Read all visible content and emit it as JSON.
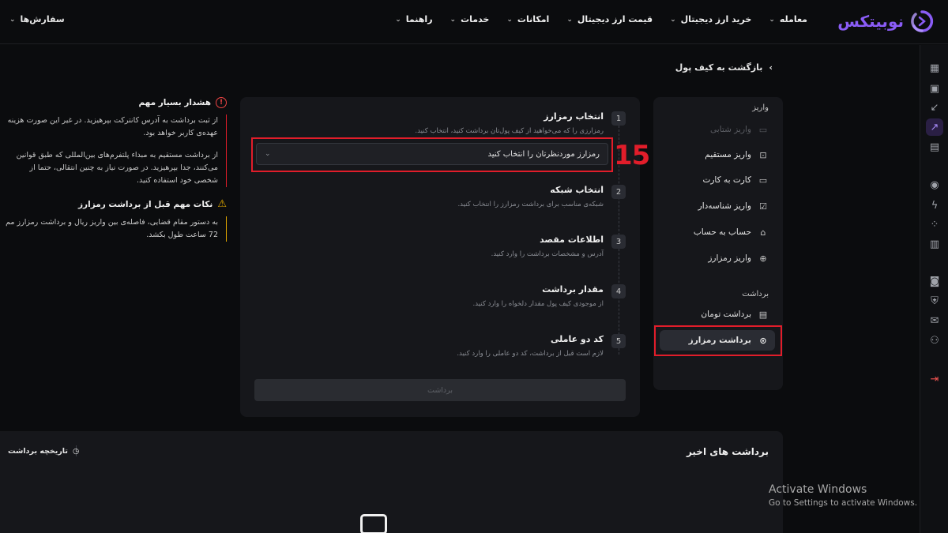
{
  "nav": {
    "logo_text": "نوبیتکس",
    "menu": [
      {
        "label": "معامله"
      },
      {
        "label": "خرید ارز دیجیتال"
      },
      {
        "label": "قیمت ارز دیجیتال"
      },
      {
        "label": "امکانات"
      },
      {
        "label": "خدمات"
      },
      {
        "label": "راهنما"
      }
    ],
    "orders_label": "سفارش‌ها"
  },
  "breadcrumb": {
    "back_label": "بازگشت به کیف پول"
  },
  "side": {
    "deposit_heading": "واریز",
    "deposit_items": [
      {
        "label": "واریز شتابی",
        "icon": "card-fast-icon",
        "disabled": true
      },
      {
        "label": "واریز مستقیم",
        "icon": "direct-deposit-icon"
      },
      {
        "label": "کارت به کارت",
        "icon": "card-transfer-icon"
      },
      {
        "label": "واریز شناسه‌دار",
        "icon": "id-deposit-icon"
      },
      {
        "label": "حساب به حساب",
        "icon": "bank-icon"
      },
      {
        "label": "واریز رمزارز",
        "icon": "crypto-deposit-icon"
      }
    ],
    "withdraw_heading": "برداشت",
    "withdraw_items": [
      {
        "label": "برداشت تومان",
        "icon": "toman-withdraw-icon"
      },
      {
        "label": "برداشت رمزارز",
        "icon": "crypto-withdraw-icon",
        "active": true
      }
    ]
  },
  "steps": [
    {
      "num": "1",
      "title": "انتخاب رمزارز",
      "desc": "رمزارزی را که می‌خواهید از کیف پول‌تان برداشت کنید، انتخاب کنید."
    },
    {
      "num": "2",
      "title": "انتخاب شبکه",
      "desc": "شبکه‌ی مناسب برای برداشت رمزارز را انتخاب کنید."
    },
    {
      "num": "3",
      "title": "اطلاعات مقصد",
      "desc": "آدرس و مشخصات برداشت را وارد کنید."
    },
    {
      "num": "4",
      "title": "مقدار برداشت",
      "desc": "از موجودی کیف پول مقدار دلخواه را وارد کنید."
    },
    {
      "num": "5",
      "title": "کد دو عاملی",
      "desc": "لازم است قبل از برداشت، کد دو عاملی را وارد کنید."
    }
  ],
  "coin_select": {
    "placeholder": "رمزارز موردنظرتان را انتخاب کنید"
  },
  "submit_label": "برداشت",
  "annotation_number": "15",
  "warning": {
    "title": "هشدار بسیار مهم",
    "lines": [
      "از ثبت برداشت به آدرس کانترکت بپرهیزید. در غیر این صورت هزینه",
      "عهده‌ی کاربر خواهد بود.",
      "از برداشت مستقیم به مبداء پلتفرم‌های بین‌المللی که طبق قوانین",
      "می‌کنند، جدا بپرهیزید. در صورت نیاز به چنین انتقالی، حتما از",
      "شخصی خود استفاده کنید."
    ]
  },
  "tips": {
    "title": "نکات مهم قبل از برداشت رمزارز",
    "lines": [
      "به دستور مقام قضایی، فاصله‌ی بین واریز ریال و برداشت رمزارز مم",
      "72 ساعت طول بکشد."
    ]
  },
  "recent": {
    "title": "برداشت های اخیر",
    "history_label": "تاریخچه برداشت"
  },
  "watermark": {
    "line1": "Activate Windows",
    "line2": "Go to Settings to activate Windows."
  },
  "colors": {
    "accent": "#8a5cf6",
    "highlight": "#e11d2a",
    "warning": "#e0a800"
  }
}
